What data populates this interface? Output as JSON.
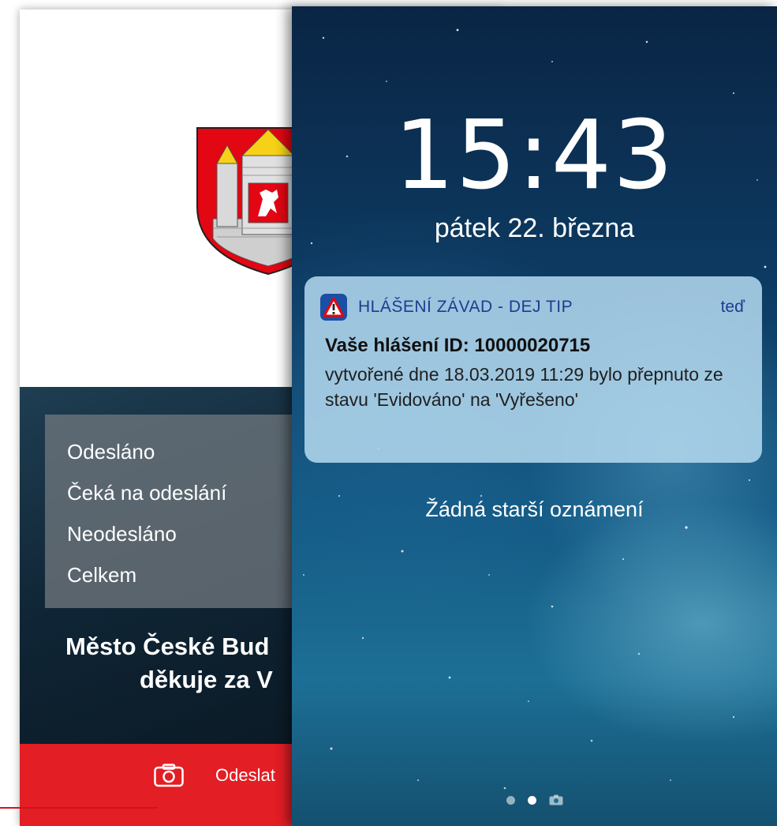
{
  "app": {
    "stats": [
      {
        "label": "Odesláno"
      },
      {
        "label": "Čeká na odeslání"
      },
      {
        "label": "Neodesláno"
      },
      {
        "label": "Celkem"
      }
    ],
    "thanks_line1": "Město České Bud",
    "thanks_line2": "děkuje za V",
    "send_label": "Odeslat",
    "icons": {
      "crest": "coat-of-arms",
      "camera": "camera-icon"
    },
    "colors": {
      "brand_red": "#e31e24",
      "dark_panel": "#0f2535"
    }
  },
  "lock": {
    "time": "15:43",
    "date": "pátek 22. března",
    "notification": {
      "app_name": "HLÁŠENÍ ZÁVAD - DEJ TIP",
      "time": "teď",
      "title": "Vaše hlášení ID: 10000020715",
      "body": "vytvořené dne 18.03.2019 11:29 bylo přepnuto ze stavu 'Evidováno' na 'Vyřešeno'",
      "icon": "warning-icon"
    },
    "no_older": "Žádná starší oznámení"
  }
}
